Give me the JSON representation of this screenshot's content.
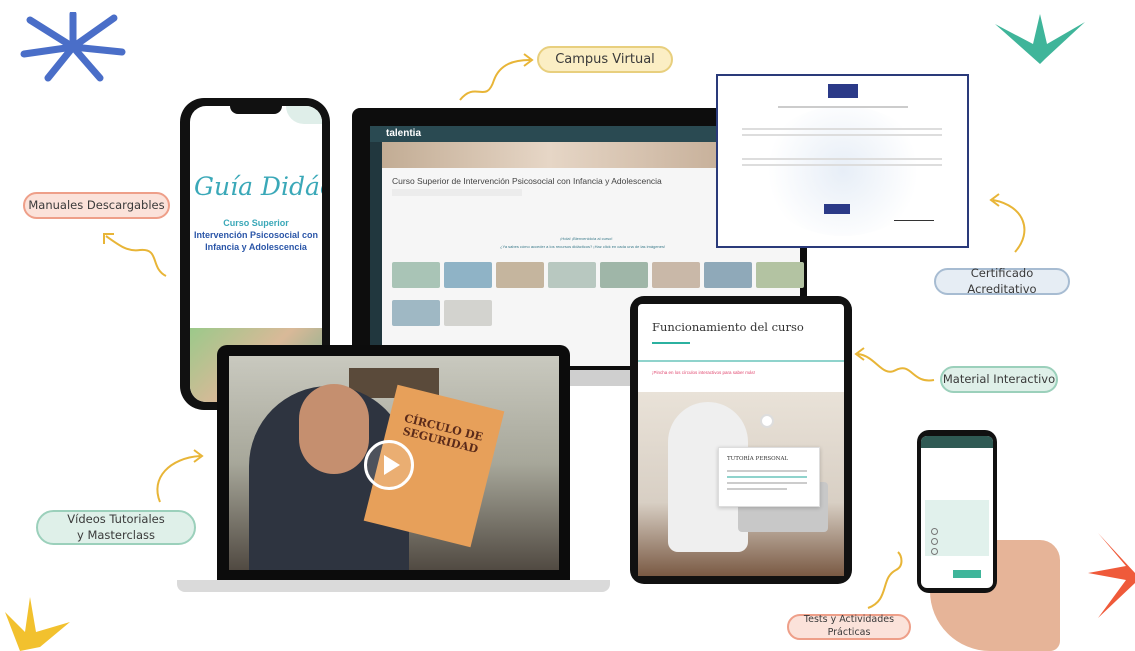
{
  "labels": {
    "campus_virtual": "Campus Virtual",
    "manuales": "Manuales Descargables",
    "certificado": "Certificado Acreditativo",
    "material": "Material Interactivo",
    "videos": "Vídeos Tutoriales\ny Masterclass",
    "tests": "Tests y Actividades Prácticas"
  },
  "phone_guide": {
    "title": "Guía Didácti",
    "course_line1": "Curso Superior",
    "course_line2": "Intervención Psicosocial con",
    "course_line3": "Infancia y Adolescencia"
  },
  "campus": {
    "logo": "talentia",
    "course_title": "Curso Superior de Intervención Psicosocial con Infancia y Adolescencia",
    "welcome": "¡Hola! ¡Bienvenido/a al curso!",
    "subtitle": "¿Ya sabes cómo acceder a los recursos didácticos? ¡Haz click en cada una de las imágenes!"
  },
  "laptop_book": {
    "title": "CÍRCULO DE SEGURIDAD"
  },
  "tablet": {
    "heading": "Funcionamiento del curso",
    "tagline": "¡Pincha en los círculos interactivos para saber más!",
    "popup_title": "TUTORÍA PERSONAL"
  },
  "colors": {
    "accent_yellow": "#f2c12e",
    "accent_teal": "#2bb1a0",
    "accent_blue": "#3b5db8",
    "accent_red": "#ef5a3a"
  }
}
